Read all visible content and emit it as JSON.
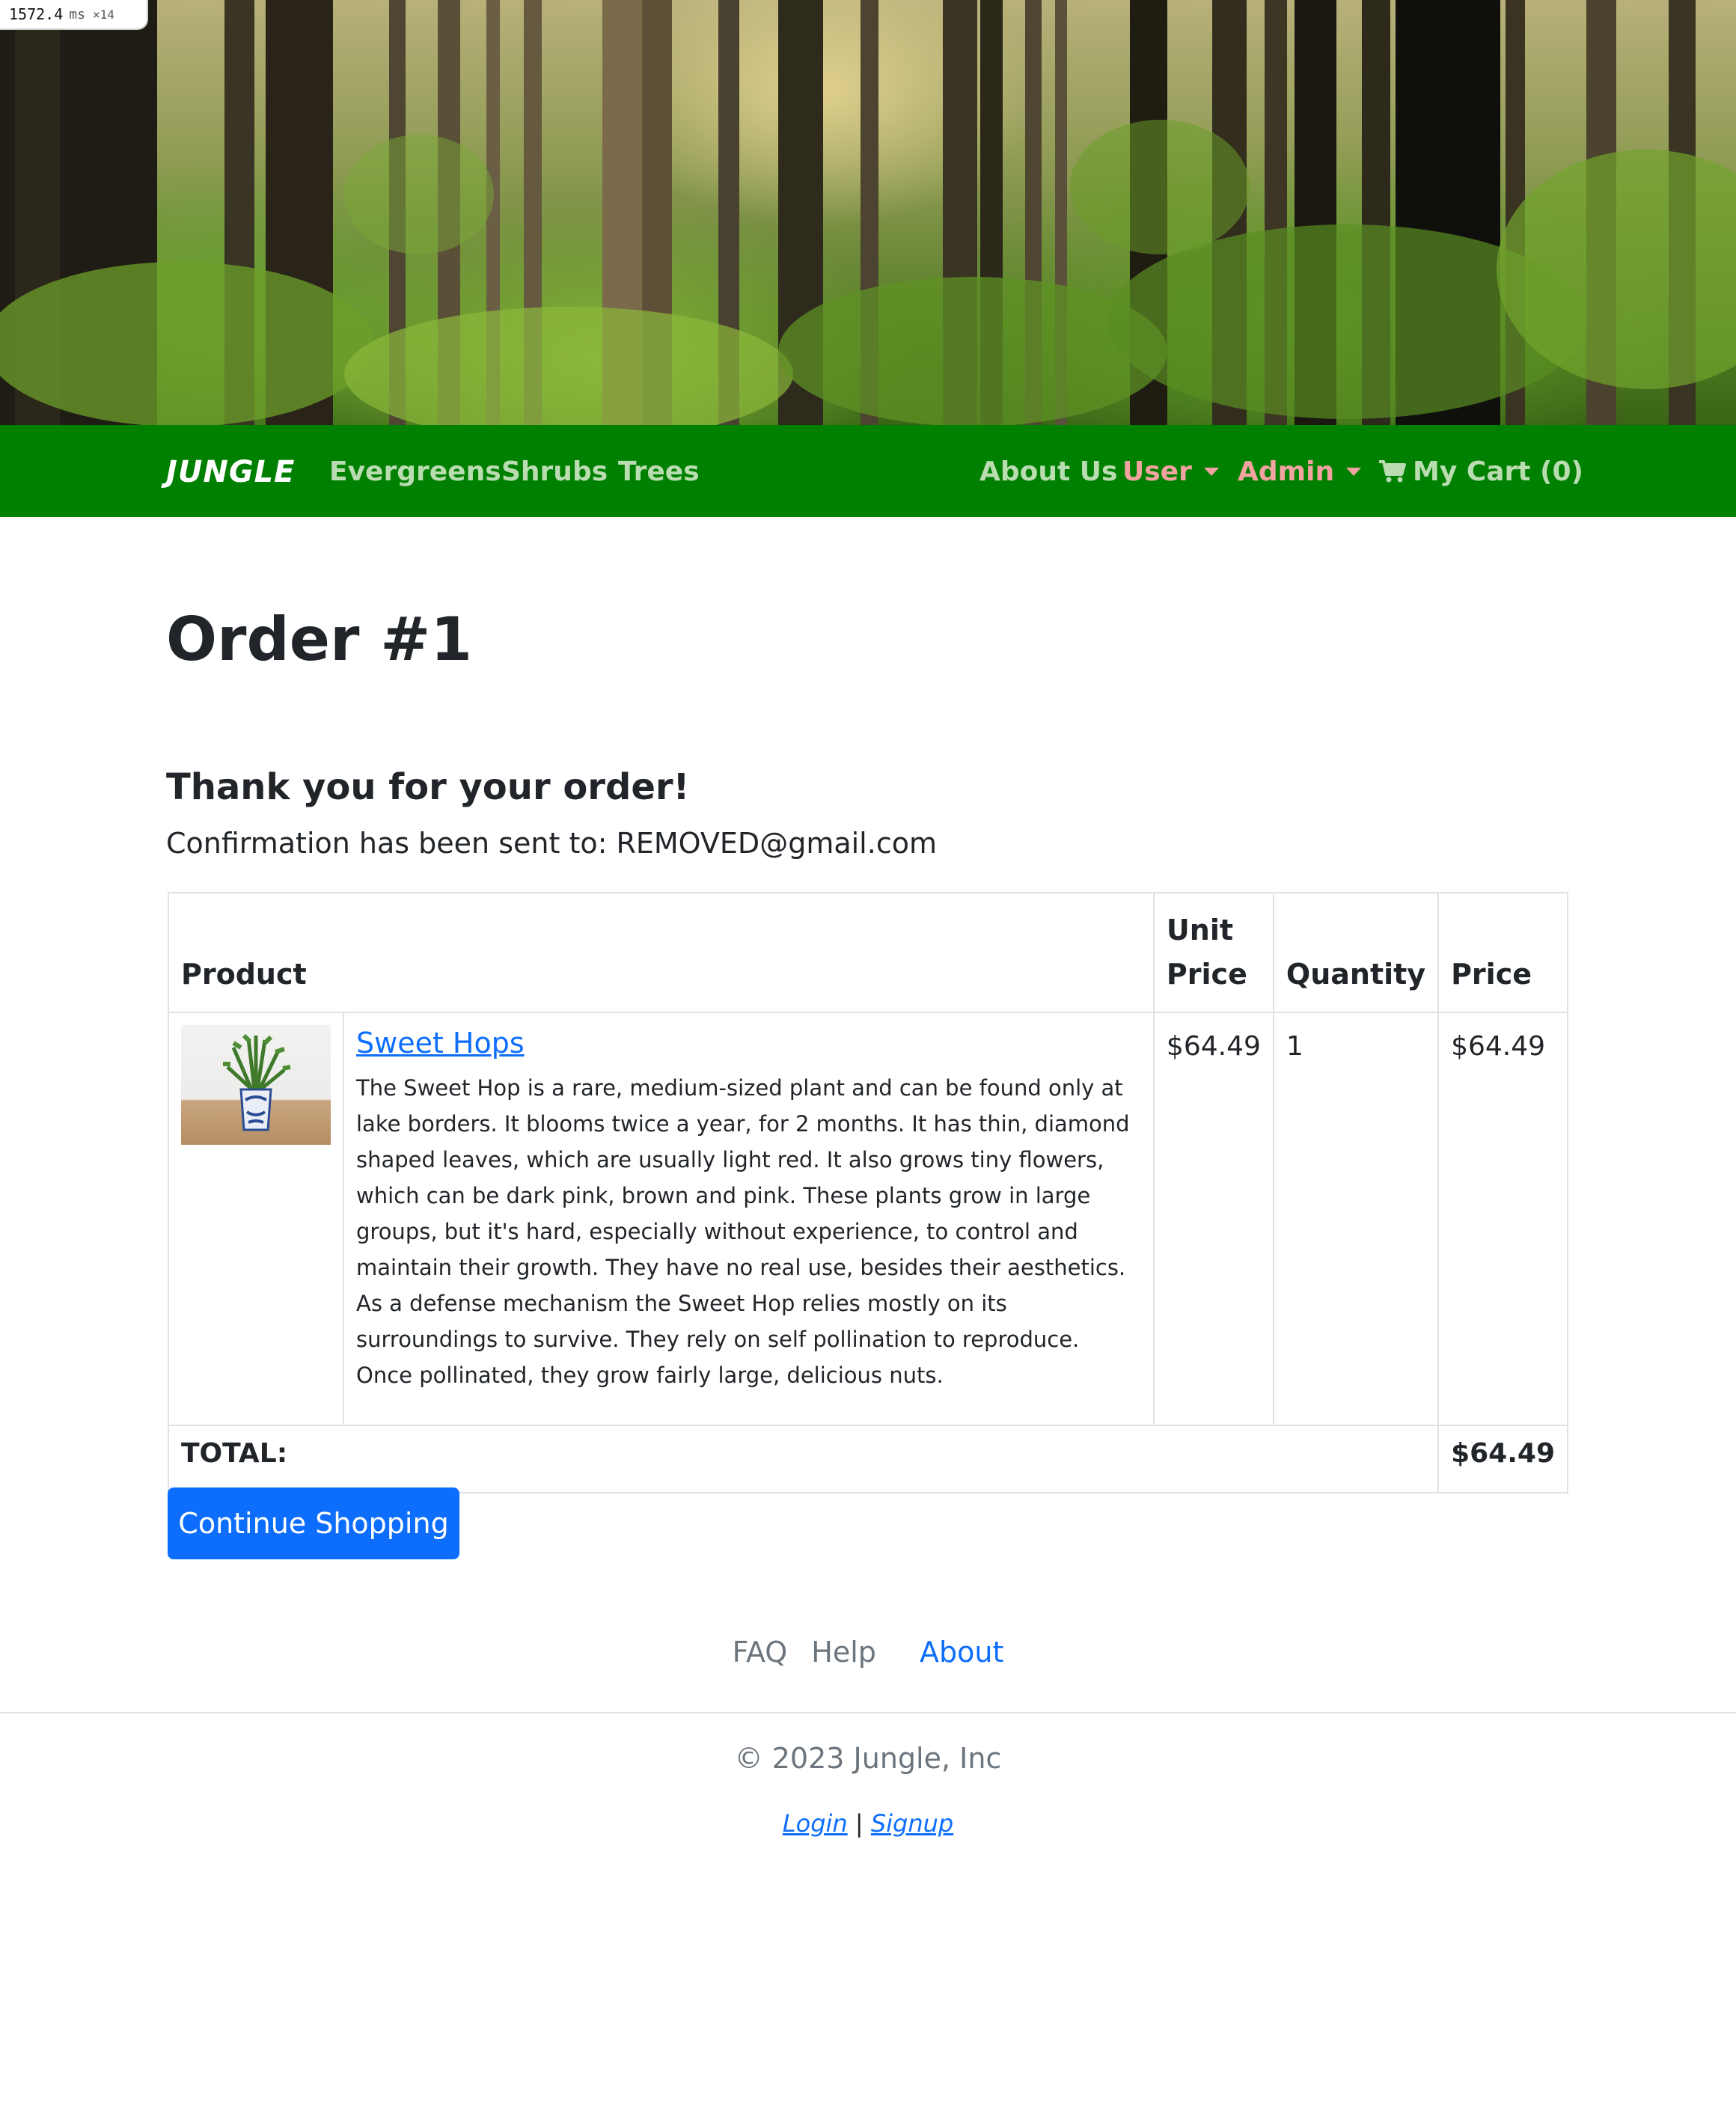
{
  "perf": {
    "value": "1572.4",
    "unit": "ms",
    "multiplier": "×14"
  },
  "nav": {
    "brand": "JUNGLE",
    "left_items": [
      "Evergreens",
      "Shrubs",
      "Trees"
    ],
    "about": "About Us",
    "user": "User",
    "admin": "Admin",
    "cart": "My Cart (0)"
  },
  "order": {
    "title": "Order #1",
    "thanks": "Thank you for your order!",
    "confirmation": "Confirmation has been sent to: REMOVED@gmail.com"
  },
  "table": {
    "headers": [
      "Product",
      "Unit Price",
      "Quantity",
      "Price"
    ],
    "rows": [
      {
        "name": "Sweet Hops",
        "description": "The Sweet Hop is a rare, medium-sized plant and can be found only at lake borders. It blooms twice a year, for 2 months. It has thin, diamond shaped leaves, which are usually light red. It also grows tiny flowers, which can be dark pink, brown and pink. These plants grow in large groups, but it's hard, especially without experience, to control and maintain their growth. They have no real use, besides their aesthetics. As a defense mechanism the Sweet Hop relies mostly on its surroundings to survive. They rely on self pollination to reproduce. Once pollinated, they grow fairly large, delicious nuts.",
        "unit_price": "$64.49",
        "quantity": "1",
        "price": "$64.49"
      }
    ],
    "total_label": "TOTAL:",
    "total_value": "$64.49"
  },
  "continue_button": "Continue Shopping",
  "footer": {
    "links": [
      "FAQ",
      "Help",
      "About"
    ],
    "copyright": "© 2023 Jungle, Inc",
    "login": "Login",
    "separator": "|",
    "signup": "Signup"
  },
  "colors": {
    "navbar": "#008000",
    "primary": "#0d6efd",
    "nav_link": "#b9dcb1",
    "nav_dropdown": "#f3a3a0"
  }
}
